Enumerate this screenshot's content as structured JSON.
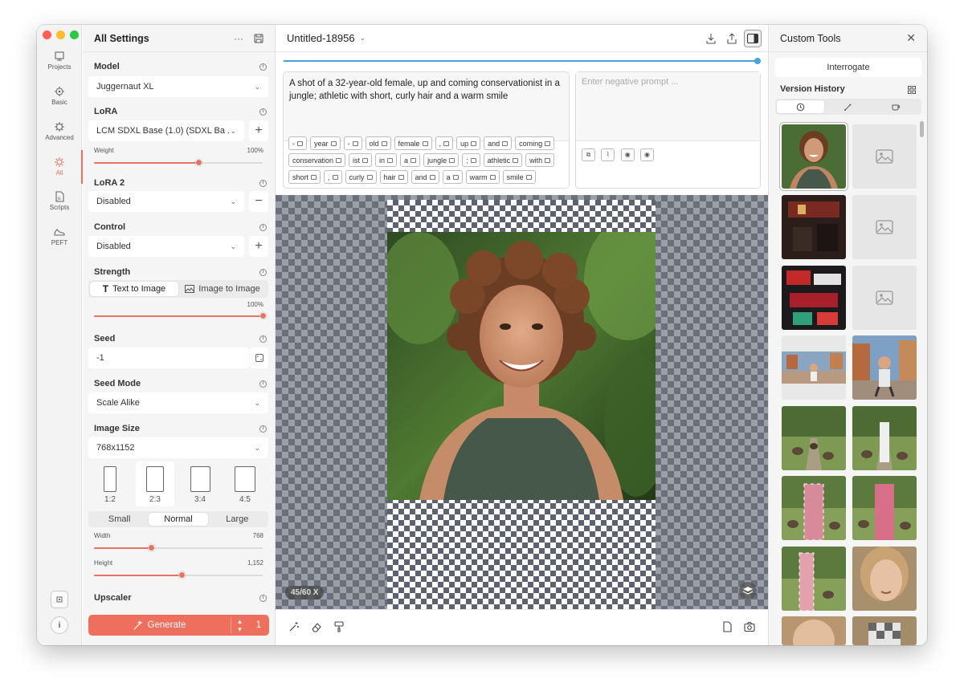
{
  "rail": {
    "items": [
      {
        "label": "Projects"
      },
      {
        "label": "Basic"
      },
      {
        "label": "Advanced"
      },
      {
        "label": "All"
      },
      {
        "label": "Scripts"
      },
      {
        "label": "PEFT"
      }
    ]
  },
  "settings": {
    "title": "All Settings",
    "model": {
      "label": "Model",
      "value": "Juggernaut XL"
    },
    "lora": {
      "label": "LoRA",
      "value": "LCM SDXL Base (1.0) (SDXL Ba ...",
      "weight_label": "Weight",
      "weight_value": "100%",
      "weight_level": 0.62
    },
    "lora2": {
      "label": "LoRA 2",
      "value": "Disabled"
    },
    "control": {
      "label": "Control",
      "value": "Disabled"
    },
    "strength": {
      "label": "Strength",
      "mode_text": "Text to Image",
      "mode_image": "Image to Image",
      "value": "100%",
      "level": 1.0
    },
    "seed": {
      "label": "Seed",
      "value": "-1"
    },
    "seed_mode": {
      "label": "Seed Mode",
      "value": "Scale Alike"
    },
    "image_size": {
      "label": "Image Size",
      "value": "768x1152",
      "ratios": [
        "1:2",
        "2:3",
        "3:4",
        "4:5"
      ],
      "selected_ratio": "2:3",
      "sizes": [
        "Small",
        "Normal",
        "Large"
      ],
      "selected_size": "Normal",
      "width_label": "Width",
      "width_value": "768",
      "width_level": 0.34,
      "height_label": "Height",
      "height_value": "1,152",
      "height_level": 0.52
    },
    "upscaler": {
      "label": "Upscaler"
    },
    "generate": {
      "label": "Generate",
      "count": "1"
    }
  },
  "canvas": {
    "title": "Untitled-18956",
    "progress": 1.0,
    "prompt": "A shot of a 32-year-old female, up and coming conservationist in a jungle; athletic with short, curly hair and a warm smile",
    "negative_placeholder": "Enter negative prompt ...",
    "tokens": [
      "-",
      "year",
      "-",
      "old",
      "female",
      ",",
      "up",
      "and",
      "coming",
      "conservation",
      "ist",
      "in",
      "a",
      "jungle",
      ";",
      "athletic",
      "with",
      "short",
      ",",
      "curly",
      "hair",
      "and",
      "a",
      "warm",
      "smile"
    ],
    "zoom": "45/60 X"
  },
  "right": {
    "title": "Custom Tools",
    "interrogate": "Interrogate",
    "version_history": "Version History"
  },
  "colors": {
    "accent": "#ef6f5e",
    "progress": "#4aa3df",
    "traffic_red": "#ff5f57",
    "traffic_yellow": "#febc2e",
    "traffic_green": "#28c840"
  }
}
